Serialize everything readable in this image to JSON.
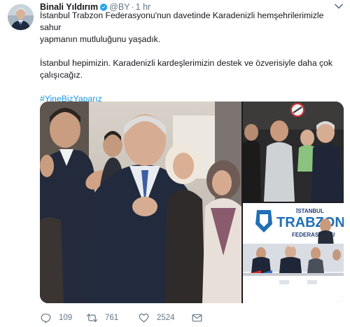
{
  "tweet": {
    "author": {
      "display_name": "Binali Yıldırım",
      "handle": "@BY",
      "separator": "·",
      "time": "1 hr",
      "verified": true,
      "avatar_icon": "profile-photo"
    },
    "text": {
      "line1": "İstanbul Trabzon Federasyonu'nun davetinde Karadenizli hemşehrilerimizle sahur",
      "line2": "yapmanın mutluluğunu yaşadık.",
      "line3": "İstanbul hepimizin. Karadenizli kardeşlerimizin destek ve özverisiyle daha çok",
      "line4": "çalışıcağız.",
      "hashtag": "#YineBizYaparız"
    },
    "media": {
      "photo_count": 3,
      "banner_text": {
        "line1": "İSTANBUL",
        "line2": "TRABZON",
        "line3": "FEDERASYONU"
      }
    },
    "actions": {
      "reply_icon": "reply-icon",
      "reply_count": "109",
      "retweet_icon": "retweet-icon",
      "retweet_count": "761",
      "like_icon": "heart-icon",
      "like_count": "2524",
      "dm_icon": "envelope-icon"
    }
  },
  "colors": {
    "link": "#1b95e0",
    "secondary_text": "#657786",
    "primary_text": "#14171a",
    "verified_badge": "#1da1f2",
    "background": "#ffffff"
  }
}
